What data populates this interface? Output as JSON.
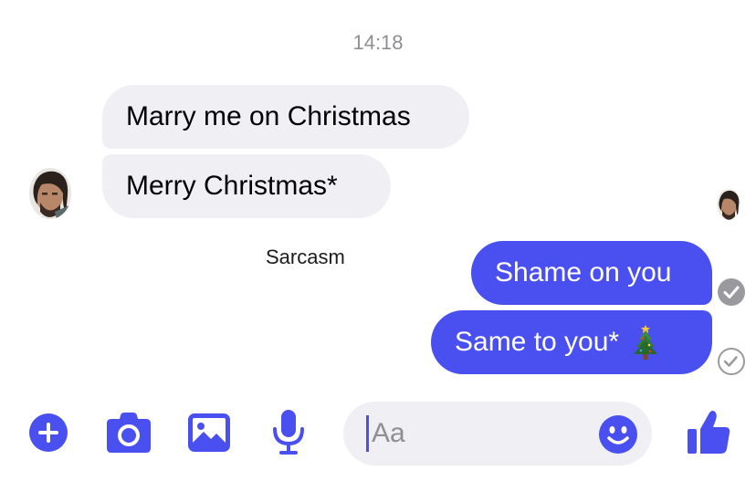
{
  "thread": {
    "timestamp": "14:18",
    "messages": [
      {
        "direction": "received",
        "text": "Marry me on Christmas"
      },
      {
        "direction": "received",
        "text": "Merry Christmas*"
      },
      {
        "direction": "sent",
        "text": "Shame on you",
        "status": "read"
      },
      {
        "direction": "sent",
        "text": "Same to you*",
        "emoji": "christmas-tree-icon",
        "status": "delivered"
      }
    ],
    "caption": "Sarcasm"
  },
  "composer": {
    "placeholder": "Aa",
    "icons": [
      "plus-icon",
      "camera-icon",
      "image-icon",
      "microphone-icon",
      "smiley-icon",
      "thumbs-up-icon"
    ]
  },
  "colors": {
    "accent": "#4a4ff0",
    "received_bubble": "#f0eff4",
    "muted_text": "#8e8e93",
    "status_gray": "#9a9a9e"
  }
}
